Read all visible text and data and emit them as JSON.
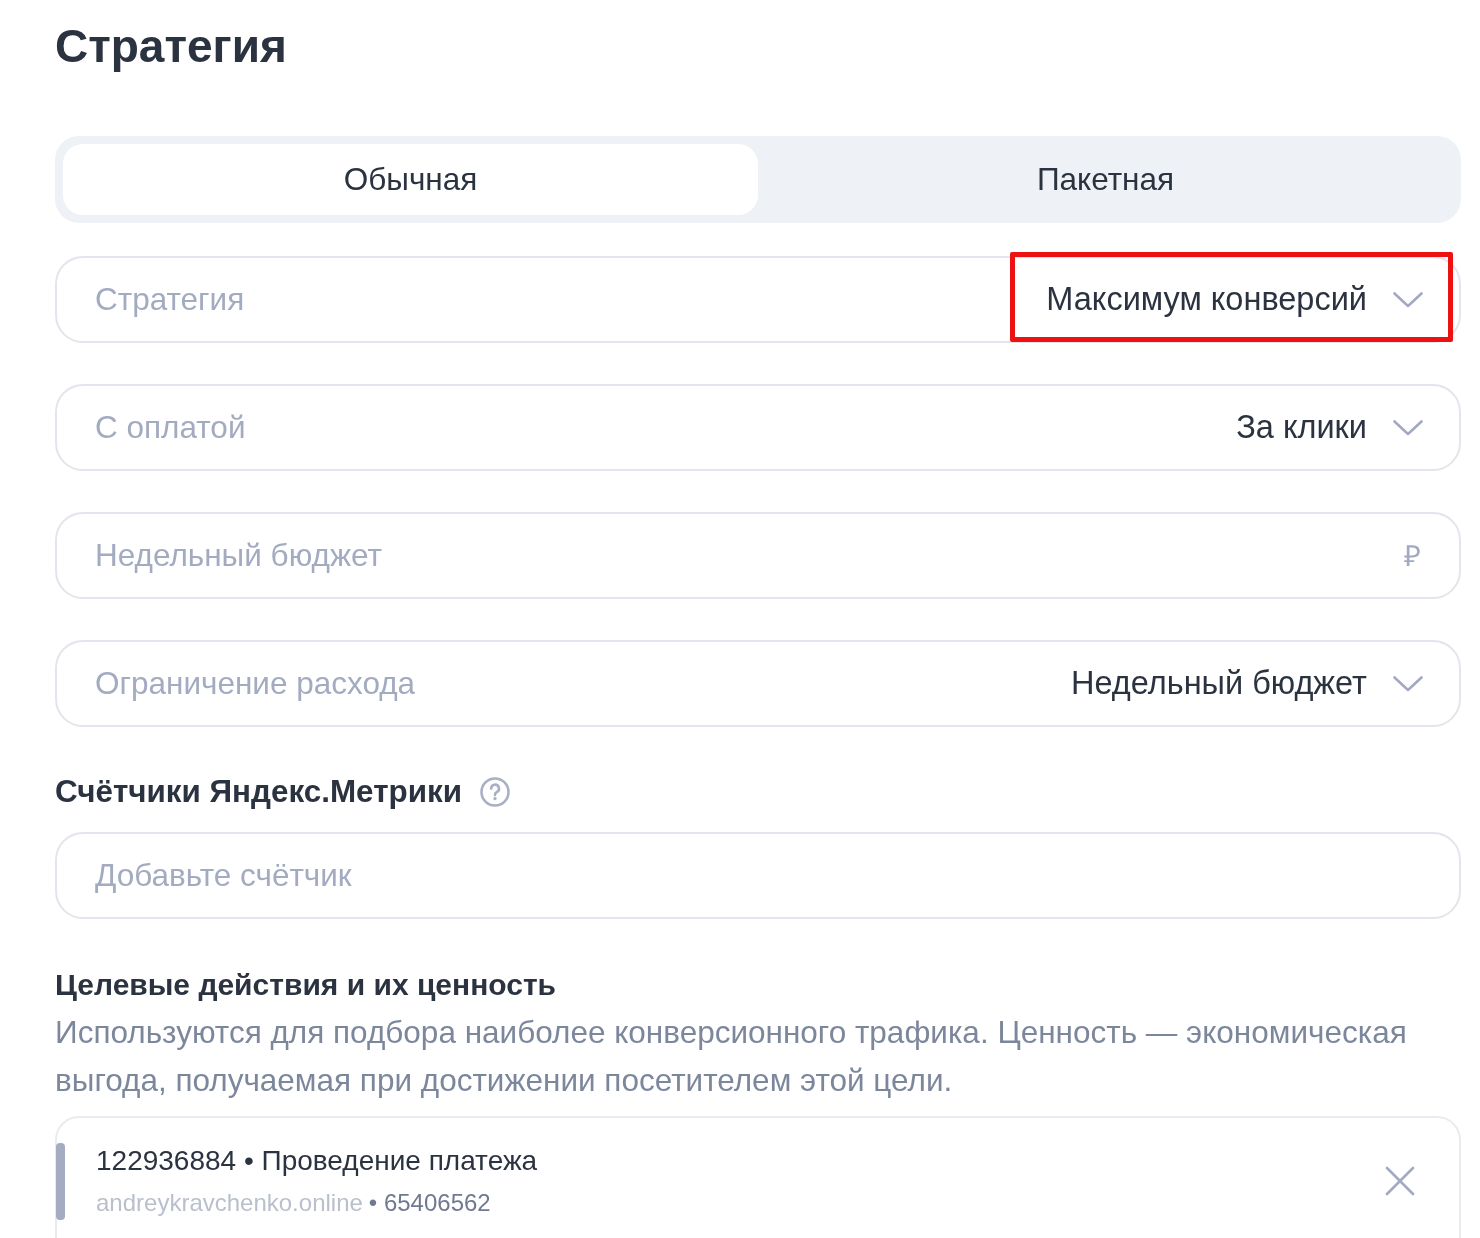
{
  "title": "Стратегия",
  "tabs": [
    {
      "label": "Обычная",
      "selected": true
    },
    {
      "label": "Пакетная",
      "selected": false
    }
  ],
  "fields": [
    {
      "kind": "select",
      "label": "Стратегия",
      "value": "Максимум конверсий",
      "highlighted": true
    },
    {
      "kind": "select",
      "label": "С оплатой",
      "value": "За клики",
      "highlighted": false
    },
    {
      "kind": "input",
      "placeholder": "Недельный бюджет",
      "suffix": "₽",
      "highlighted": false
    },
    {
      "kind": "select",
      "label": "Ограничение расхода",
      "value": "Недельный бюджет",
      "highlighted": false
    }
  ],
  "metrics": {
    "heading": "Счётчики Яндекс.Метрики",
    "placeholder": "Добавьте счётчик"
  },
  "goals": {
    "heading": "Целевые действия и их ценность",
    "description": "Используются для подбора наиболее конверсионного трафика. Ценность — экономическая выгода, получаемая при достижении посетителем этой цели.",
    "items": [
      {
        "title": "122936884 • Проведение платежа",
        "site": "andreykravchenko.online",
        "counter": "• 65406562"
      }
    ]
  }
}
